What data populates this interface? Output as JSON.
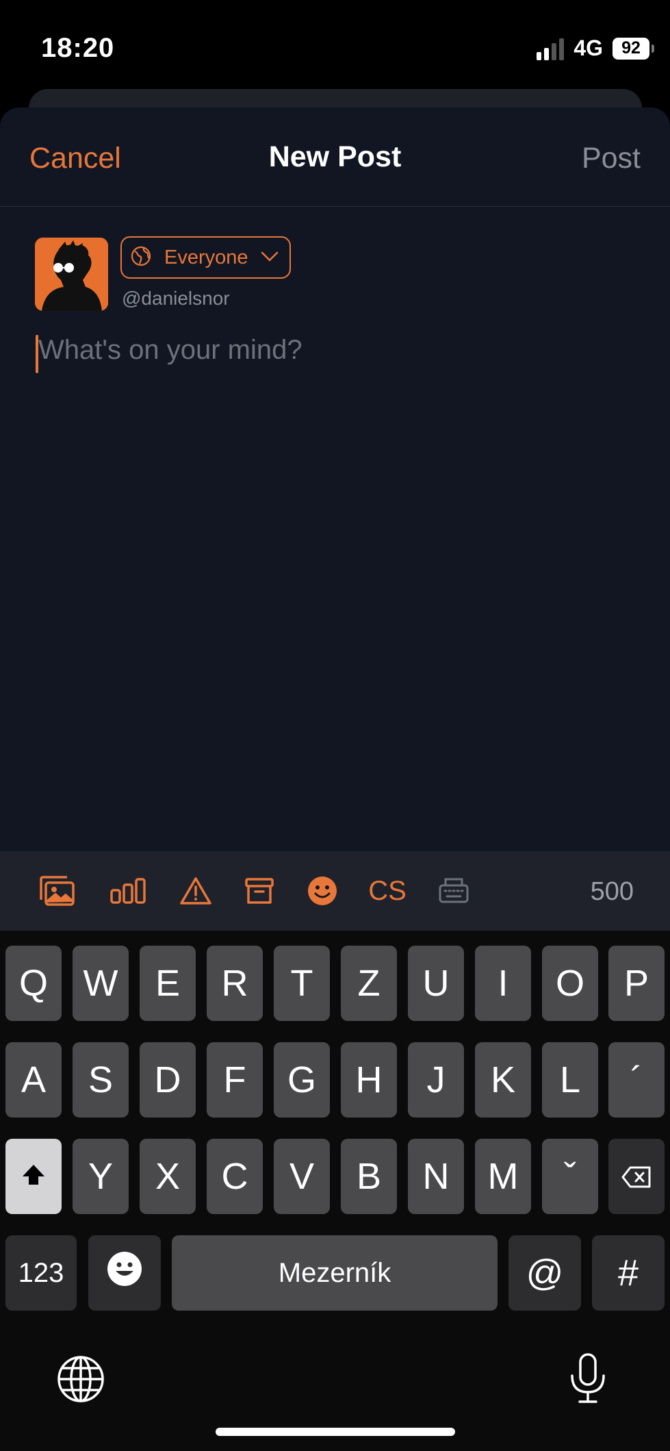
{
  "status_bar": {
    "time": "18:20",
    "network": "4G",
    "battery": "92"
  },
  "nav": {
    "cancel_label": "Cancel",
    "title": "New Post",
    "post_label": "Post"
  },
  "composer": {
    "audience_label": "Everyone",
    "handle": "@danielsnor",
    "placeholder": "What's on your mind?"
  },
  "toolbar": {
    "icons": [
      "image-gallery-icon",
      "poll-icon",
      "warning-icon",
      "archive-icon",
      "emoji-icon",
      "keyboard-icon"
    ],
    "cs_label": "CS",
    "char_count": "500"
  },
  "keyboard": {
    "row1": [
      "Q",
      "W",
      "E",
      "R",
      "T",
      "Z",
      "U",
      "I",
      "O",
      "P"
    ],
    "row2": [
      "A",
      "S",
      "D",
      "F",
      "G",
      "H",
      "J",
      "K",
      "L",
      "´"
    ],
    "row3": [
      "Y",
      "X",
      "C",
      "V",
      "B",
      "N",
      "M",
      "ˇ"
    ],
    "numbers_label": "123",
    "space_label": "Mezerník",
    "at_label": "@",
    "hash_label": "#"
  },
  "colors": {
    "accent": "#e8773a",
    "sheet_bg": "#121622",
    "key_bg": "#4a4a4d"
  }
}
